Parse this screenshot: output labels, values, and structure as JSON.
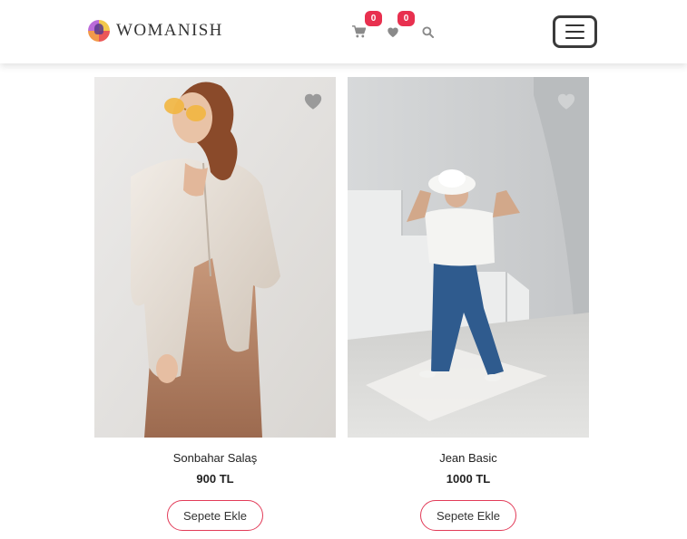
{
  "brand": {
    "name": "WOMANISH"
  },
  "nav": {
    "cart": {
      "icon": "cart-icon",
      "count": "0"
    },
    "favorites": {
      "icon": "heart-icon",
      "count": "0"
    },
    "search": {
      "icon": "search-icon"
    },
    "menu": {
      "icon": "hamburger-menu-icon"
    }
  },
  "colors": {
    "accent": "#e8304f",
    "badge_text": "#ffffff",
    "icon_gray": "#8a8a8a"
  },
  "products": [
    {
      "name": "Sonbahar Salaş",
      "price": "900 TL",
      "button_label": "Sepete Ekle",
      "favorite_icon": "heart-icon"
    },
    {
      "name": "Jean Basic",
      "price": "1000 TL",
      "button_label": "Sepete Ekle",
      "favorite_icon": "heart-icon"
    }
  ]
}
